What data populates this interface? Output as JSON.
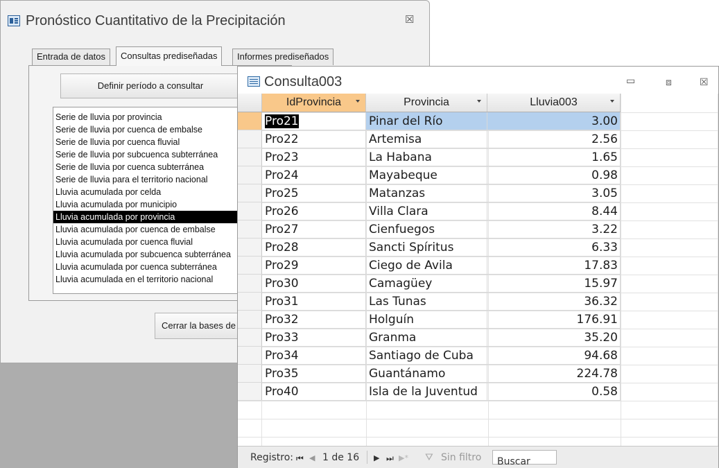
{
  "form": {
    "title": "Pronóstico Cuantitativo de la Precipitación",
    "close_glyph": "☒",
    "tabs": [
      {
        "label": "Entrada de datos",
        "active": false
      },
      {
        "label": "Consultas prediseñadas",
        "active": true
      },
      {
        "label": "Informes prediseñados",
        "active": false
      }
    ],
    "define_button": "Definir período a consultar",
    "close_db_button": "Cerrar la bases de datos",
    "query_list": [
      "Serie de lluvia por provincia",
      "Serie de lluvia por cuenca de embalse",
      "Serie de lluvia por cuenca fluvial",
      "Serie de lluvia por subcuenca subterránea",
      "Serie de lluvia por cuenca subterránea",
      "Serie de lluvia para el territorio nacional",
      "Lluvia acumulada por celda",
      "Lluvia acumulada por municipio",
      "Lluvia acumulada por provincia",
      "Lluvia acumulada por cuenca de embalse",
      "Lluvia acumulada por cuenca fluvial",
      "Lluvia acumulada por subcuenca subterránea",
      "Lluvia acumulada por cuenca subterránea",
      "Lluvia acumulada en el territorio nacional"
    ],
    "selected_query": "Lluvia acumulada por provincia"
  },
  "datasheet": {
    "title": "Consulta003",
    "window_buttons": {
      "minimize": "▭",
      "maximize": "⧈",
      "close": "☒"
    },
    "columns": [
      "IdProvincia",
      "Provincia",
      "Lluvia003"
    ],
    "rows": [
      {
        "id": "Pro21",
        "provincia": "Pinar del Río",
        "lluvia": "3.00"
      },
      {
        "id": "Pro22",
        "provincia": "Artemisa",
        "lluvia": "2.56"
      },
      {
        "id": "Pro23",
        "provincia": "La Habana",
        "lluvia": "1.65"
      },
      {
        "id": "Pro24",
        "provincia": "Mayabeque",
        "lluvia": "0.98"
      },
      {
        "id": "Pro25",
        "provincia": "Matanzas",
        "lluvia": "3.05"
      },
      {
        "id": "Pro26",
        "provincia": "Villa Clara",
        "lluvia": "8.44"
      },
      {
        "id": "Pro27",
        "provincia": "Cienfuegos",
        "lluvia": "3.22"
      },
      {
        "id": "Pro28",
        "provincia": "Sancti Spíritus",
        "lluvia": "6.33"
      },
      {
        "id": "Pro29",
        "provincia": "Ciego de Avila",
        "lluvia": "17.83"
      },
      {
        "id": "Pro30",
        "provincia": "Camagüey",
        "lluvia": "15.97"
      },
      {
        "id": "Pro31",
        "provincia": "Las Tunas",
        "lluvia": "36.32"
      },
      {
        "id": "Pro32",
        "provincia": "Holguín",
        "lluvia": "176.91"
      },
      {
        "id": "Pro33",
        "provincia": "Granma",
        "lluvia": "35.20"
      },
      {
        "id": "Pro34",
        "provincia": "Santiago de Cuba",
        "lluvia": "94.68"
      },
      {
        "id": "Pro35",
        "provincia": "Guantánamo",
        "lluvia": "224.78"
      },
      {
        "id": "Pro40",
        "provincia": "Isla de la Juventud",
        "lluvia": "0.58"
      }
    ],
    "navigation": {
      "label": "Registro:",
      "first": "⏮",
      "prev": "◀",
      "current": "1 de 16",
      "next": "▶",
      "last": "⏭",
      "new": "▶*",
      "filter_icon": "⛛",
      "filter": "Sin filtro",
      "search": "Buscar"
    }
  },
  "colors": {
    "selected_header": "#f9c88a",
    "selected_row": "#b4d0ee",
    "selected_list_item": "#000000"
  }
}
